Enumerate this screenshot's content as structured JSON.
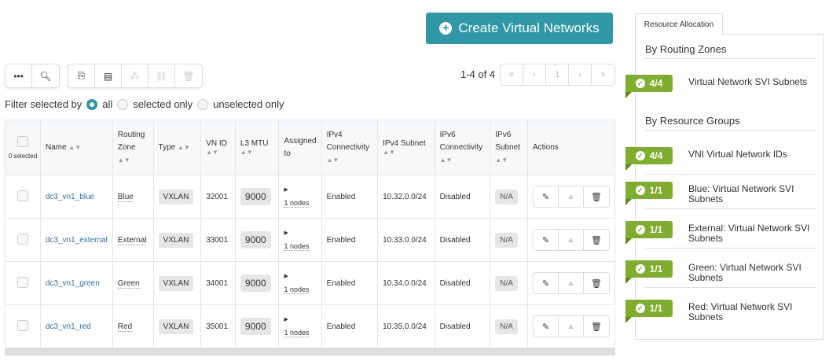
{
  "create_button": "Create Virtual Networks",
  "pagination": {
    "range": "1-4 of 4",
    "first": "«",
    "prev": "‹",
    "page": "1",
    "next": "›",
    "last": "»"
  },
  "filter": {
    "label": "Filter selected by",
    "options": [
      "all",
      "selected only",
      "unselected only"
    ],
    "selected": "all"
  },
  "table": {
    "selected_count": "0 selected",
    "headers": [
      "Name",
      "Routing Zone",
      "Type",
      "VN ID",
      "L3 MTU",
      "Assigned to",
      "IPv4 Connectivity",
      "IPv4 Subnet",
      "IPv6 Connectivity",
      "IPv6 Subnet",
      "Actions"
    ],
    "rows": [
      {
        "name": "dc3_vn1_blue",
        "zone": "Blue",
        "type": "VXLAN",
        "vnid": "32001",
        "mtu": "9000",
        "assigned": "1 nodes",
        "ipv4": "Enabled",
        "subnet": "10.32.0.0/24",
        "ipv6": "Disabled",
        "ipv6subnet": "N/A"
      },
      {
        "name": "dc3_vn1_external",
        "zone": "External",
        "type": "VXLAN",
        "vnid": "33001",
        "mtu": "9000",
        "assigned": "1 nodes",
        "ipv4": "Enabled",
        "subnet": "10.33.0.0/24",
        "ipv6": "Disabled",
        "ipv6subnet": "N/A"
      },
      {
        "name": "dc3_vn1_green",
        "zone": "Green",
        "type": "VXLAN",
        "vnid": "34001",
        "mtu": "9000",
        "assigned": "1 nodes",
        "ipv4": "Enabled",
        "subnet": "10.34.0.0/24",
        "ipv6": "Disabled",
        "ipv6subnet": "N/A"
      },
      {
        "name": "dc3_vn1_red",
        "zone": "Red",
        "type": "VXLAN",
        "vnid": "35001",
        "mtu": "9000",
        "assigned": "1 nodes",
        "ipv4": "Enabled",
        "subnet": "10.35.0.0/24",
        "ipv6": "Disabled",
        "ipv6subnet": "N/A"
      }
    ]
  },
  "resource": {
    "tab": "Resource Allocation",
    "routing_title": "By Routing Zones",
    "groups_title": "By Resource Groups",
    "routing": [
      {
        "count": "4/4",
        "label": "Virtual Network SVI Subnets"
      }
    ],
    "groups": [
      {
        "count": "4/4",
        "label": "VNI Virtual Network IDs"
      },
      {
        "count": "1/1",
        "label": "Blue: Virtual Network SVI Subnets"
      },
      {
        "count": "1/1",
        "label": "External: Virtual Network SVI Subnets"
      },
      {
        "count": "1/1",
        "label": "Green: Virtual Network SVI Subnets"
      },
      {
        "count": "1/1",
        "label": "Red: Virtual Network SVI Subnets"
      }
    ]
  },
  "colors": {
    "accent": "#2f97a6",
    "badge": "#7fad2e"
  }
}
